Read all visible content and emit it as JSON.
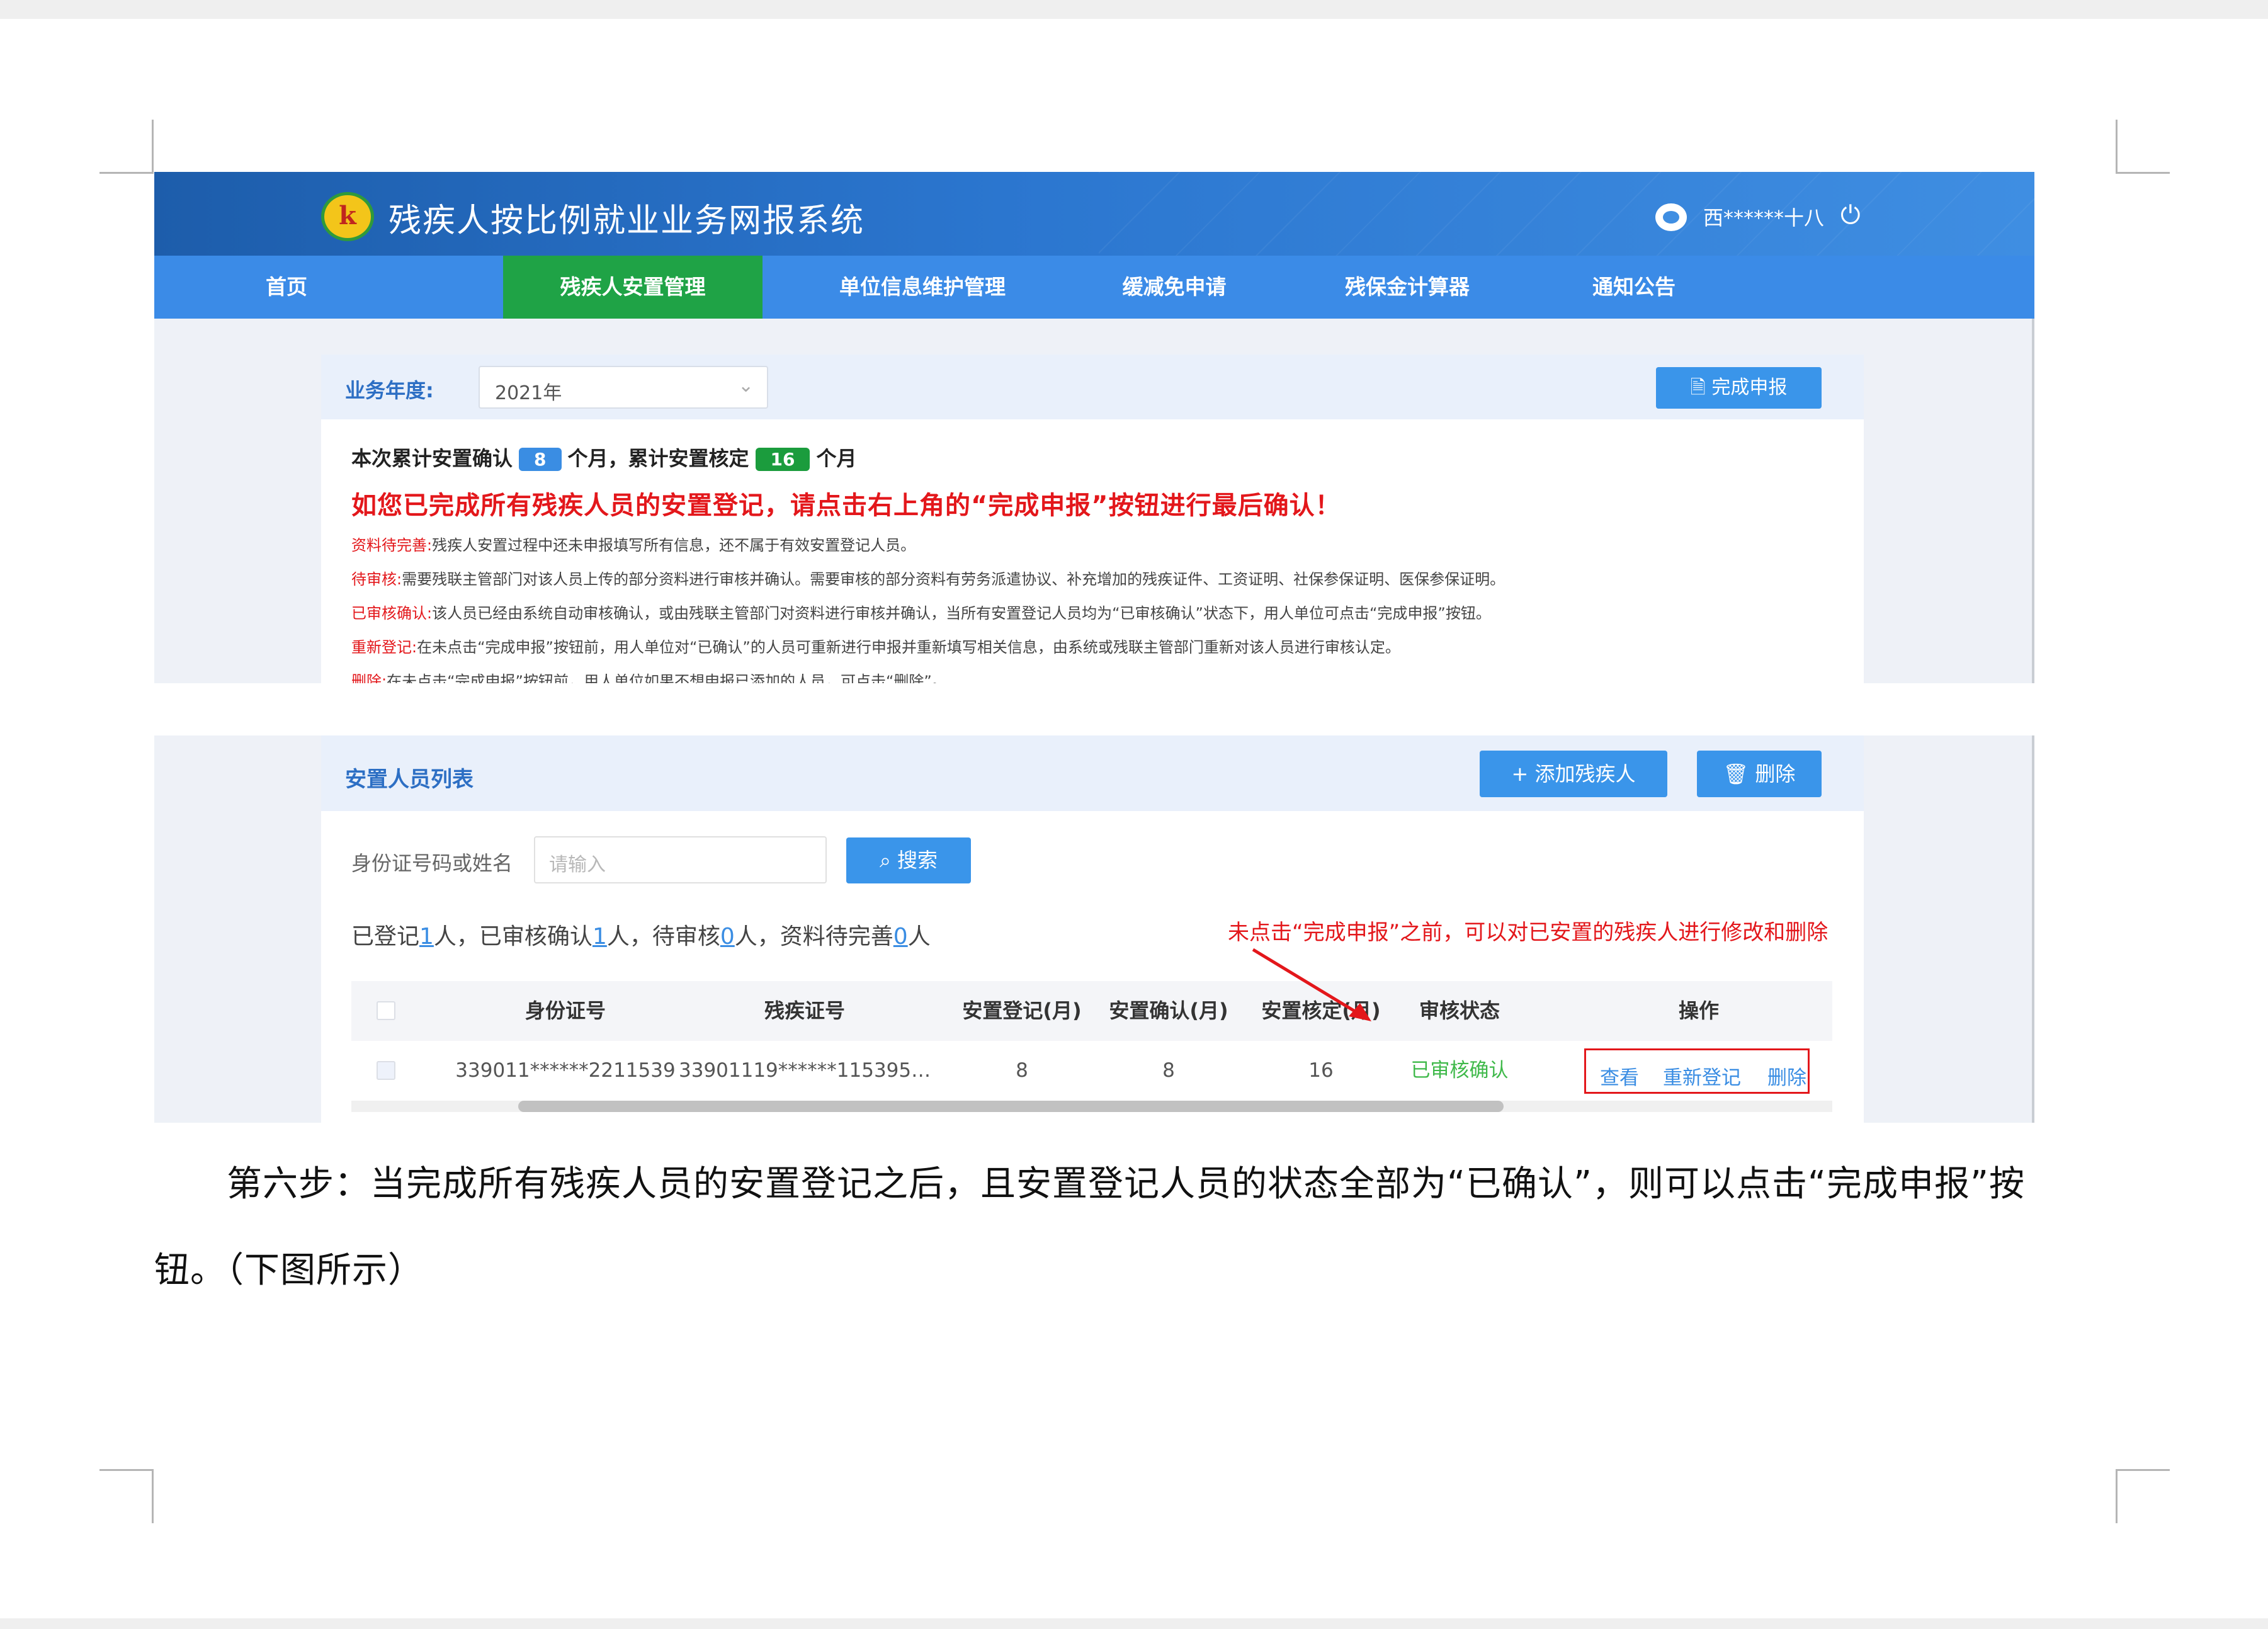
{
  "screenshot_top": {
    "app_title": "残疾人按比例就业业务网报系统",
    "logo_glyph": "k",
    "user_name": "西******十八",
    "nav": [
      "首页",
      "残疾人安置管理",
      "单位信息维护管理",
      "缓减免申请",
      "残保金计算器",
      "通知公告"
    ],
    "nav_active": "残疾人安置管理",
    "year_label": "业务年度:",
    "year_value": "2021年",
    "finish_button": "完成申报",
    "summary": {
      "prefix": "本次累计安置确认",
      "confirm_months": "8",
      "mid": "个月，累计安置核定",
      "approve_months": "16",
      "suffix": "个月"
    },
    "warning": "如您已完成所有残疾人员的安置登记，请点击右上角的“完成申报”按钮进行最后确认！",
    "notes": [
      {
        "key": "资料待完善:",
        "text": "残疾人安置过程中还未申报填写所有信息，还不属于有效安置登记人员。"
      },
      {
        "key": "待审核:",
        "text": "需要残联主管部门对该人员上传的部分资料进行审核并确认。需要审核的部分资料有劳务派遣协议、补充增加的残疾证件、工资证明、社保参保证明、医保参保证明。"
      },
      {
        "key": "已审核确认:",
        "text": "该人员已经由系统自动审核确认，或由残联主管部门对资料进行审核并确认，当所有安置登记人员均为“已审核确认”状态下，用人单位可点击“完成申报”按钮。"
      },
      {
        "key": "重新登记:",
        "text": "在未点击“完成申报”按钮前，用人单位对“已确认”的人员可重新进行申报并重新填写相关信息，由系统或残联主管部门重新对该人员进行审核认定。"
      },
      {
        "key": "删除:",
        "text": "在未点击“完成申报”按钮前，用人单位如果不想申报已添加的人员，可点击“删除”。"
      }
    ]
  },
  "screenshot_bottom": {
    "list_title": "安置人员列表",
    "add_button": "+ 添加残疾人",
    "delete_button": "删除",
    "search_label": "身份证号码或姓名",
    "search_placeholder": "请输入",
    "search_button": "搜索",
    "stats": {
      "t1": "已登记",
      "n1": "1",
      "t2": "人，已审核确认",
      "n2": "1",
      "t3": "人，待审核",
      "n3": "0",
      "t4": "人，资料待完善",
      "n4": "0",
      "t5": "人"
    },
    "hint": "未点击“完成申报”之前，可以对已安置的残疾人进行修改和删除",
    "columns": [
      "身份证号",
      "残疾证号",
      "安置登记(月)",
      "安置确认(月)",
      "安置核定(月)",
      "审核状态",
      "操作"
    ],
    "rows": [
      {
        "id_no": "339011******2211539",
        "disability_no": "33901119******115395…",
        "reg": "8",
        "confirm": "8",
        "approve": "16",
        "status": "已审核确认"
      }
    ],
    "row_actions": [
      "查看",
      "重新登记",
      "删除"
    ],
    "colors": {
      "status_ok": "#3fb94a",
      "highlight": "#e3171b",
      "primary": "#3a95ea"
    }
  },
  "paragraph": {
    "line1": "第六步：当完成所有残疾人员的安置登记之后，且安置登记人员的状态全部为“已确认”，则可以点击“完成申报”按",
    "line2": "钮。（下图所示）"
  }
}
